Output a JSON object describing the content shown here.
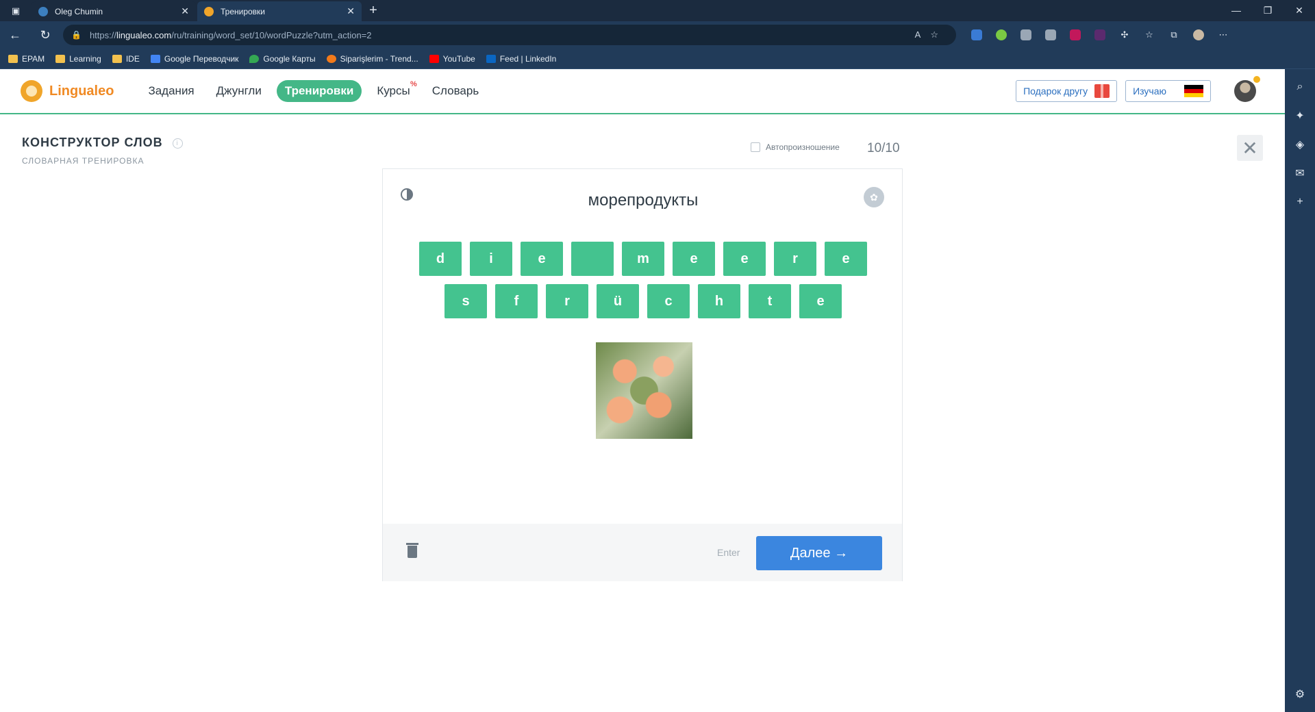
{
  "browser": {
    "tabs": [
      {
        "title": "Oleg Chumin",
        "active": false
      },
      {
        "title": "Тренировки",
        "active": true
      }
    ],
    "url_prefix": "https://",
    "url_host": "lingualeo.com",
    "url_path": "/ru/training/word_set/10/wordPuzzle?utm_action=2",
    "bookmarks": [
      "EPAM",
      "Learning",
      "IDE",
      "Google Переводчик",
      "Google Карты",
      "Siparişlerim - Trend...",
      "YouTube",
      "Feed | LinkedIn"
    ]
  },
  "site": {
    "logo": "Lingualeo",
    "nav": [
      "Задания",
      "Джунгли",
      "Тренировки",
      "Курсы",
      "Словарь"
    ],
    "courses_badge": "%",
    "gift_button": "Подарок другу",
    "learning_button": "Изучаю"
  },
  "training": {
    "title": "КОНСТРУКТОР СЛОВ",
    "info": "i",
    "subtitle": "СЛОВАРНАЯ ТРЕНИРОВКА",
    "autopronounce": "Автопроизношение",
    "counter": "10/10",
    "word": "морепродукты",
    "row1": [
      "d",
      "i",
      "e",
      "",
      "m",
      "e",
      "e",
      "r",
      "e"
    ],
    "row2": [
      "s",
      "f",
      "r",
      "ü",
      "c",
      "h",
      "t",
      "e"
    ],
    "enter_hint": "Enter",
    "next_button": "Далее →"
  },
  "colors": {
    "accent_green": "#44b787",
    "letter_green": "#44c38f",
    "button_blue": "#3b86df",
    "logo_orange": "#f08a24"
  }
}
